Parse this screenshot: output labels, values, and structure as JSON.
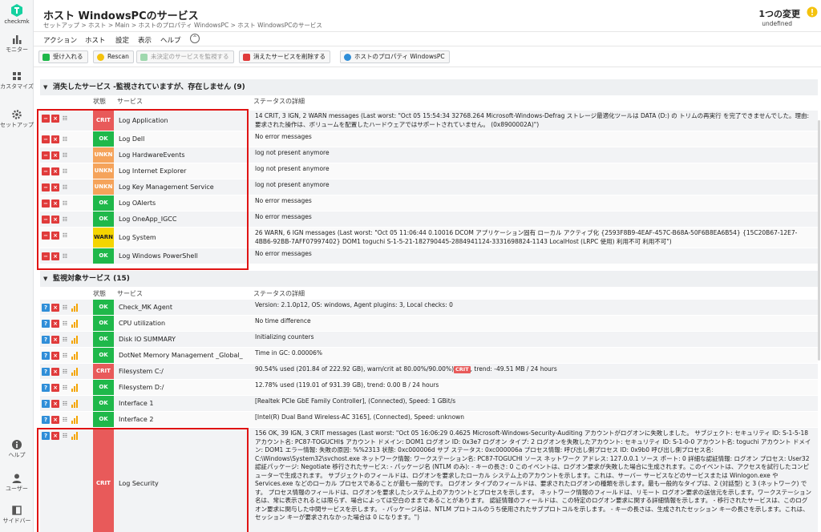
{
  "sidebar": {
    "logo_label": "checkmk",
    "items": [
      {
        "label": "モニター",
        "icon": "bar-chart-icon"
      },
      {
        "label": "カスタマイズ",
        "icon": "customize-icon"
      },
      {
        "label": "セットアップ",
        "icon": "gear-icon"
      },
      {
        "label": "ヘルプ",
        "icon": "info-icon"
      },
      {
        "label": "ユーザー",
        "icon": "user-icon"
      },
      {
        "label": "サイドバー",
        "icon": "sidebar-icon"
      }
    ]
  },
  "header": {
    "title": "ホスト WindowsPCのサービス",
    "breadcrumb": "セットアップ > ホスト > Main > ホストのプロパティ WindowsPC > ホスト WindowsPCのサービス",
    "changes": "1つの変更",
    "changes_sub": "undefined"
  },
  "menu": [
    "アクション",
    "ホスト",
    "設定",
    "表示",
    "ヘルプ"
  ],
  "toolbar": [
    {
      "label": "受け入れる",
      "color": "#1fb84a",
      "disabled": false
    },
    {
      "label": "Rescan",
      "color": "#f4c20d",
      "disabled": false
    },
    {
      "label": "未決定のサービスを監視する",
      "color": "#9fd8ae",
      "disabled": true
    },
    {
      "label": "消えたサービスを削除する",
      "color": "#e03b3b",
      "disabled": false
    },
    {
      "label": "ホストのプロパティ WindowsPC",
      "color": "#2f8ed8",
      "disabled": false
    }
  ],
  "vanished": {
    "heading": "消失したサービス -監視されていますが、存在しません (9)",
    "col_state": "状態",
    "col_service": "サービス",
    "col_detail": "ステータスの詳細",
    "rows": [
      {
        "state": "CRIT",
        "service": "Log Application",
        "detail": "14 CRIT, 3 IGN, 2 WARN messages (Last worst: \"Oct 05 15:54:34 32768.264 Microsoft-Windows-Defrag ストレージ最適化ツールは DATA (D:) の トリムの再実行 を完了できませんでした。理由: 要求された操作は、ボリュームを配置したハードウェアではサポートされていません。 (0x8900002A)\")"
      },
      {
        "state": "OK",
        "service": "Log Dell",
        "detail": "No error messages"
      },
      {
        "state": "UNKN",
        "service": "Log HardwareEvents",
        "detail": "log not present anymore"
      },
      {
        "state": "UNKN",
        "service": "Log Internet Explorer",
        "detail": "log not present anymore"
      },
      {
        "state": "UNKN",
        "service": "Log Key Management Service",
        "detail": "log not present anymore"
      },
      {
        "state": "OK",
        "service": "Log OAlerts",
        "detail": "No error messages"
      },
      {
        "state": "OK",
        "service": "Log OneApp_IGCC",
        "detail": "No error messages"
      },
      {
        "state": "WARN",
        "service": "Log System",
        "detail": "26 WARN, 6 IGN messages (Last worst: \"Oct 05 11:06:44 0.10016 DCOM アプリケーション固有 ローカル アクティブ化 {2593F8B9-4EAF-457C-B68A-50F6B8EA6B54} {15C20B67-12E7-4BB6-92BB-7AFF07997402} DOM1 toguchi S-1-5-21-182790445-2884941124-3331698824-1143 LocalHost (LRPC 使用) 利用不可 利用不可\")"
      },
      {
        "state": "OK",
        "service": "Log Windows PowerShell",
        "detail": "No error messages"
      }
    ]
  },
  "monitored": {
    "heading": "監視対象サービス (15)",
    "col_state": "状態",
    "col_service": "サービス",
    "col_detail": "ステータスの詳細",
    "rows": [
      {
        "state": "OK",
        "service": "Check_MK Agent",
        "detail": "Version: 2.1.0p12, OS: windows, Agent plugins: 3, Local checks: 0"
      },
      {
        "state": "OK",
        "service": "CPU utilization",
        "detail": "No time difference"
      },
      {
        "state": "OK",
        "service": "Disk IO SUMMARY",
        "detail": "Initializing counters"
      },
      {
        "state": "OK",
        "service": "DotNet Memory Management _Global_",
        "detail": "Time in GC: 0.00006%"
      },
      {
        "state": "CRIT",
        "service": "Filesystem C:/",
        "detail_pre": "90.54% used (201.84 of 222.92 GB), warn/crit at 80.00%/90.00%)",
        "detail_badge": "CRIT",
        "detail_post": ", trend: -49.51 MB / 24 hours"
      },
      {
        "state": "OK",
        "service": "Filesystem D:/",
        "detail": "12.78% used (119.01 of 931.39 GB), trend: 0.00 B / 24 hours"
      },
      {
        "state": "OK",
        "service": "Interface 1",
        "detail": "[Realtek PCIe GbE Family Controller], (Connected), Speed: 1 GBit/s"
      },
      {
        "state": "OK",
        "service": "Interface 2",
        "detail": "[Intel(R) Dual Band Wireless-AC 3165], (Connected), Speed: unknown"
      },
      {
        "state": "CRIT",
        "service": "Log Security",
        "detail": "156 OK, 39 IGN, 3 CRIT messages (Last worst: \"Oct 05 16:06:29 0.4625 Microsoft-Windows-Security-Auditing アカウントがログオンに失敗しました。 サブジェクト: セキュリティ ID: S-1-5-18 アカウント名: PC87-TOGUCHI$ アカウント ドメイン: DOM1 ログオン ID: 0x3e7 ログオン タイプ: 2 ログオンを失敗したアカウント: セキュリティ ID: S-1-0-0 アカウント名: toguchi アカウント ドメイン: DOM1 エラー情報: 失敗の原因: %%2313 状態: 0xc000006d サブ ステータス: 0xc000006a プロセス情報: 呼び出し側プロセス ID: 0x9b0 呼び出し側プロセス名: C:\\Windows\\System32\\svchost.exe ネットワーク情報: ワークステーション名: PC87-TOGUCHI ソース ネットワーク アドレス: 127.0.0.1 ソース ポート: 0 詳細な認証情報: ログオン プロセス: User32 認証パッケージ: Negotiate 移行されたサービス: - パッケージ名 (NTLM のみ): - キーの長さ: 0 このイベントは、ログオン要求が失敗した場合に生成されます。このイベントは、アクセスを試行したコンピューターで生成されます。 サブジェクトのフィールドは、ログオンを要求したローカル システム上のアカウントを示します。これは、サーバー サービスなどのサービスまたは Winlogon.exe や Services.exe などのローカル プロセスであることが最も一般的です。 ログオン タイプのフィールドは、要求されたログオンの種類を示します。最も一般的なタイプは、2 (対話型) と 3 (ネットワーク) です。 プロセス情報のフィールドは、ログオンを要求したシステム上のアカウントとプロセスを示します。 ネットワーク情報のフィールドは、リモート ログオン要求の送信元を示します。ワークステーション名は、常に表示されるとは限らず、場合によっては空白のままであることがあります。 認証情報のフィールドは、この特定のログオン要求に関する詳細情報を示します。 - 移行されたサービスは、このログオン要求に関与した中間サービスを示します。 - パッケージ名は、NTLM プロトコルのうち使用されたサブプロトコルを示します。 - キーの長さは、生成されたセッション キーの長さを示します。これは、セッション キーが要求されなかった場合は 0 になります。\")"
      }
    ]
  }
}
